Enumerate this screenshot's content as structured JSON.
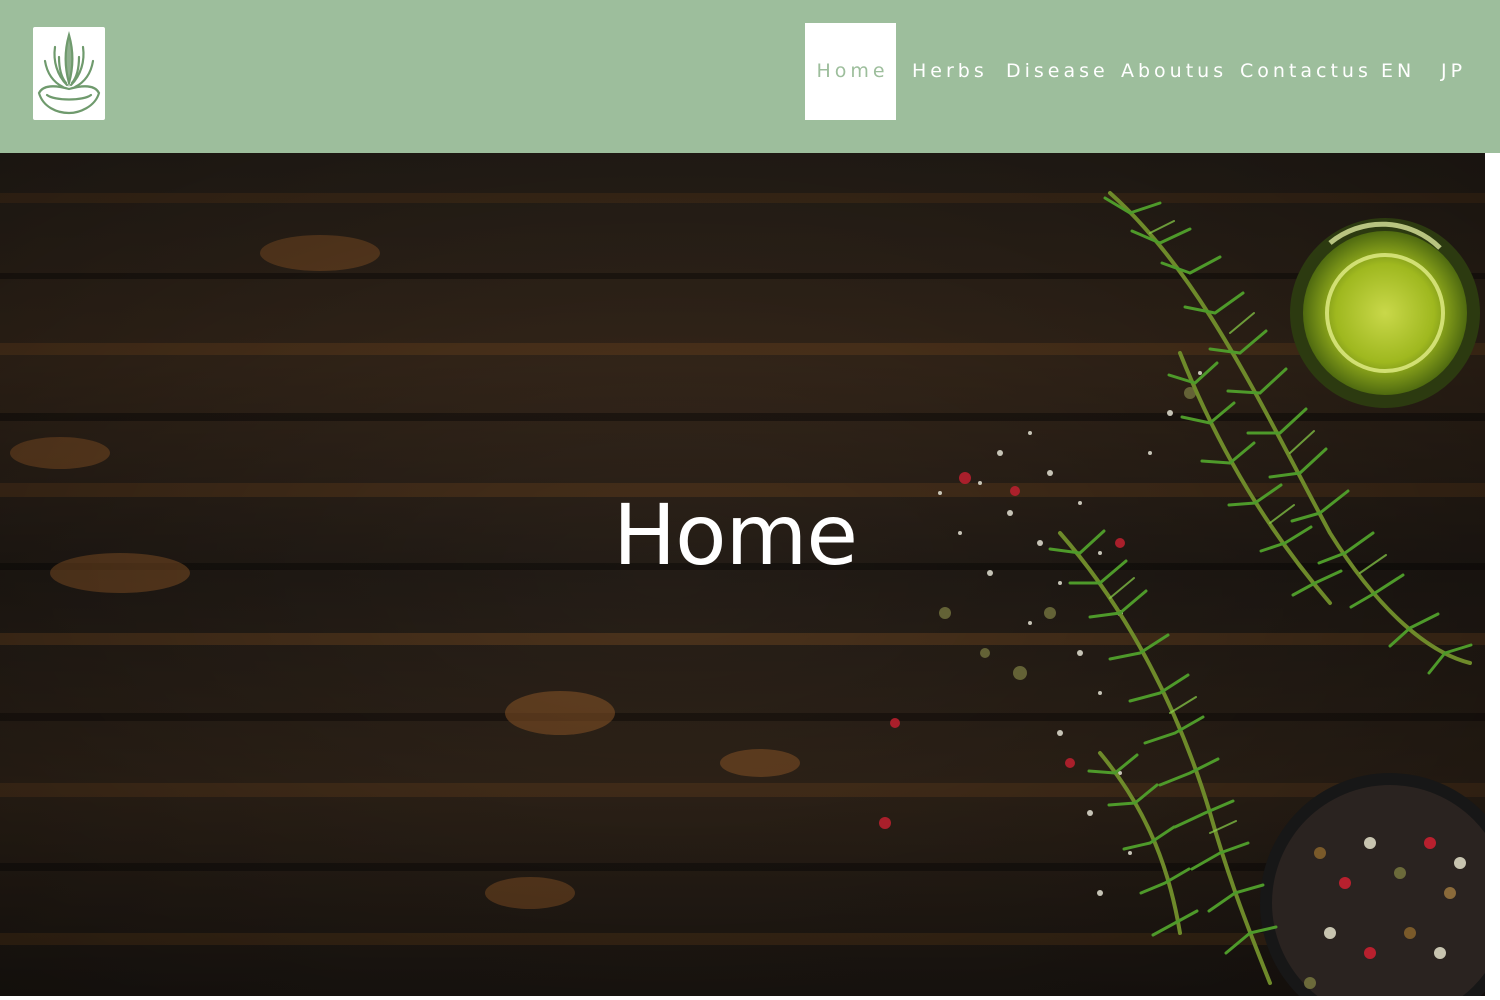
{
  "site": {
    "logo_icon": "lotus-herb-logo",
    "brand_color": "#9dbe9c"
  },
  "nav": {
    "items": [
      {
        "label": "Home",
        "active": true
      },
      {
        "label": "Herbs",
        "active": false
      },
      {
        "label": "Disease",
        "active": false
      },
      {
        "label": "Aboutus",
        "active": false
      },
      {
        "label": "Contactus",
        "active": false
      },
      {
        "label": "EN",
        "active": false
      },
      {
        "label": "JP",
        "active": false
      }
    ]
  },
  "hero": {
    "title": "Home",
    "background": "dark wooden table with rosemary, olive oil and peppercorns"
  }
}
